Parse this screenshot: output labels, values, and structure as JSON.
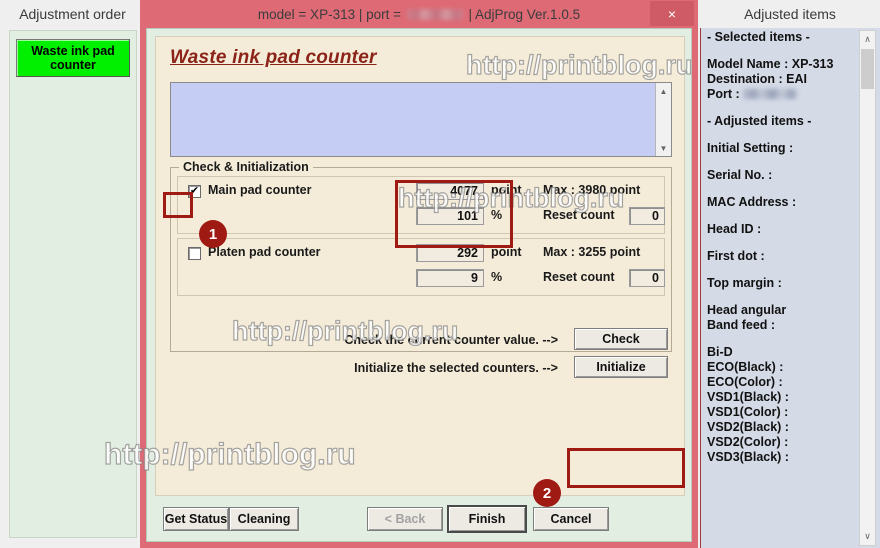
{
  "left_panel": {
    "header": "Adjustment order",
    "items": [
      {
        "label": "Waste ink pad counter",
        "state": "selected"
      }
    ]
  },
  "dialog": {
    "titlebar": {
      "model_text": "model = XP-313 | port = ",
      "port_value": "",
      "suffix_text": " | AdjProg Ver.1.0.5",
      "close_icon": "close-icon",
      "close_glyph": "×"
    },
    "page_title": "Waste ink pad counter",
    "log_text": "",
    "log_scroll": {
      "up_glyph": "▲",
      "down_glyph": "▼"
    },
    "group": {
      "legend": "Check & Initialization",
      "rows": [
        {
          "name": "main-pad-counter",
          "checkbox_label": "Main pad counter",
          "checked": true,
          "check_glyph": "✔",
          "point_value": "4077",
          "point_unit": "point",
          "max_label": "Max : 3980 point",
          "percent_value": "101",
          "percent_unit": "%",
          "reset_label": "Reset count",
          "reset_value": "0"
        },
        {
          "name": "platen-pad-counter",
          "checkbox_label": "Platen pad counter",
          "checked": false,
          "check_glyph": "",
          "point_value": "292",
          "point_unit": "point",
          "max_label": "Max : 3255 point",
          "percent_value": "9",
          "percent_unit": "%",
          "reset_label": "Reset count",
          "reset_value": "0"
        }
      ]
    },
    "actions": {
      "check_text": "Check the current counter value. -->",
      "check_button": "Check",
      "initialize_text": "Initialize the selected counters. -->",
      "initialize_button": "Initialize"
    },
    "bottom_buttons": {
      "get_status": "Get Status",
      "cleaning": "Cleaning",
      "back": "< Back",
      "finish": "Finish",
      "cancel": "Cancel"
    }
  },
  "right_panel": {
    "header": "Adjusted items",
    "selected_items_header": "- Selected items -",
    "model_name": "Model Name : XP-313",
    "destination": "Destination : EAI",
    "port_label": "Port : ",
    "adjusted_items_header": "- Adjusted items -",
    "items": [
      "Initial Setting :",
      "Serial No. :",
      "MAC Address :",
      "Head ID :",
      "First dot :",
      "Top margin :"
    ],
    "head_angular": "Head angular",
    "band_feed": " Band feed :",
    "bid_header": "Bi-D",
    "bid_items": [
      " ECO(Black)  :",
      " ECO(Color)  :",
      " VSD1(Black) :",
      " VSD1(Color) :",
      " VSD2(Black) :",
      " VSD2(Color) :",
      " VSD3(Black) :"
    ],
    "scroll": {
      "up_glyph": "∧",
      "down_glyph": "∨"
    }
  },
  "annotations": {
    "badge_1": "1",
    "badge_2": "2",
    "highlight_color": "#a01a14"
  },
  "watermark": {
    "text": "http://printblog.ru"
  }
}
